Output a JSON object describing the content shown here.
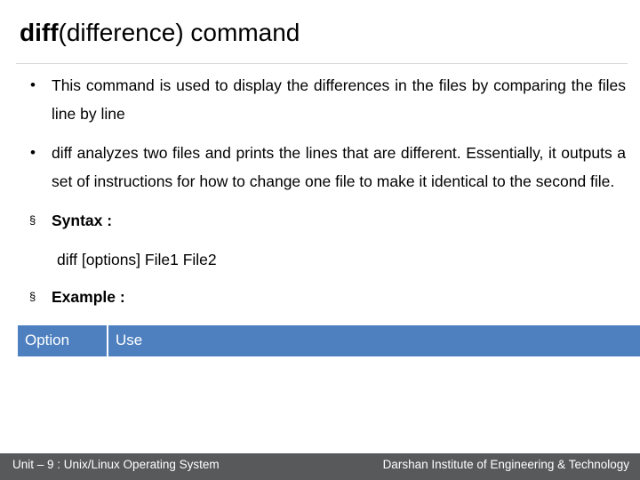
{
  "slide": {
    "title": {
      "bold_part": "diff",
      "regular_part": "(difference) command"
    },
    "bullets": [
      {
        "marker": "•",
        "marker_type": "round",
        "text": "This command is used to display the differences in the files by comparing the files line by line",
        "bold": false,
        "justified": true
      },
      {
        "marker": "•",
        "marker_type": "round",
        "text": "diff analyzes two files and prints the lines that are different. Essentially, it outputs a set of instructions for how to change one file to make it identical to the second file.",
        "bold": false,
        "justified": true
      },
      {
        "marker": "§",
        "marker_type": "square",
        "text": "Syntax :",
        "bold": true,
        "justified": false
      }
    ],
    "syntax_line": "diff [options] File1 File2",
    "example_bullet": {
      "marker": "§",
      "marker_type": "square",
      "text": "Example :",
      "bold": true
    },
    "table": {
      "headers": [
        "Option",
        "Use"
      ],
      "rows": [],
      "header_bg": "#4e80c0",
      "header_text_color": "#ffffff"
    }
  },
  "footer": {
    "left": "Unit – 9 : Unix/Linux Operating System",
    "right": "Darshan Institute of Engineering & Technology",
    "background": "#58595b",
    "text_color": "#ffffff"
  }
}
